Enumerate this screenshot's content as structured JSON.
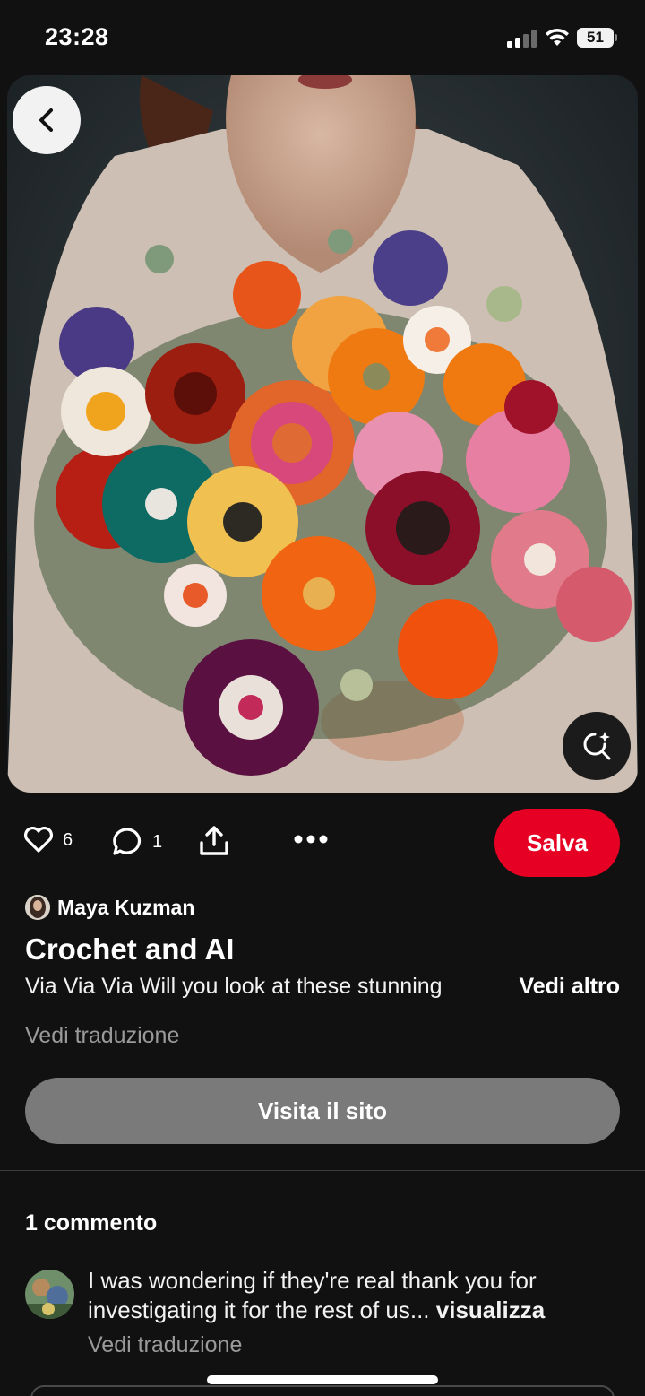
{
  "status_bar": {
    "time": "23:28",
    "battery": "51"
  },
  "pin": {
    "image_alt": "Crochet flower bouquet held by a woman",
    "likes": "6",
    "comments_count": "1",
    "save_label": "Salva",
    "author": "Maya Kuzman",
    "title": "Crochet and AI",
    "description": "Via Via Via Will you look at these stunning",
    "see_more": "Vedi altro",
    "translate": "Vedi traduzione",
    "visit_label": "Visita il sito"
  },
  "comments": {
    "heading": "1 commento",
    "items": [
      {
        "text": "I was wondering if they're real thank you for investigating it for the rest of us...",
        "more": "visualizza",
        "translate": "Vedi traduzione"
      }
    ]
  },
  "icons": [
    "chevron-left-icon",
    "lens-search-icon",
    "heart-icon",
    "comment-icon",
    "share-icon",
    "more-icon",
    "signal-icon",
    "wifi-icon",
    "battery-icon"
  ],
  "colors": {
    "save": "#e60023",
    "visit": "#7a7a7a",
    "background": "#111111"
  }
}
